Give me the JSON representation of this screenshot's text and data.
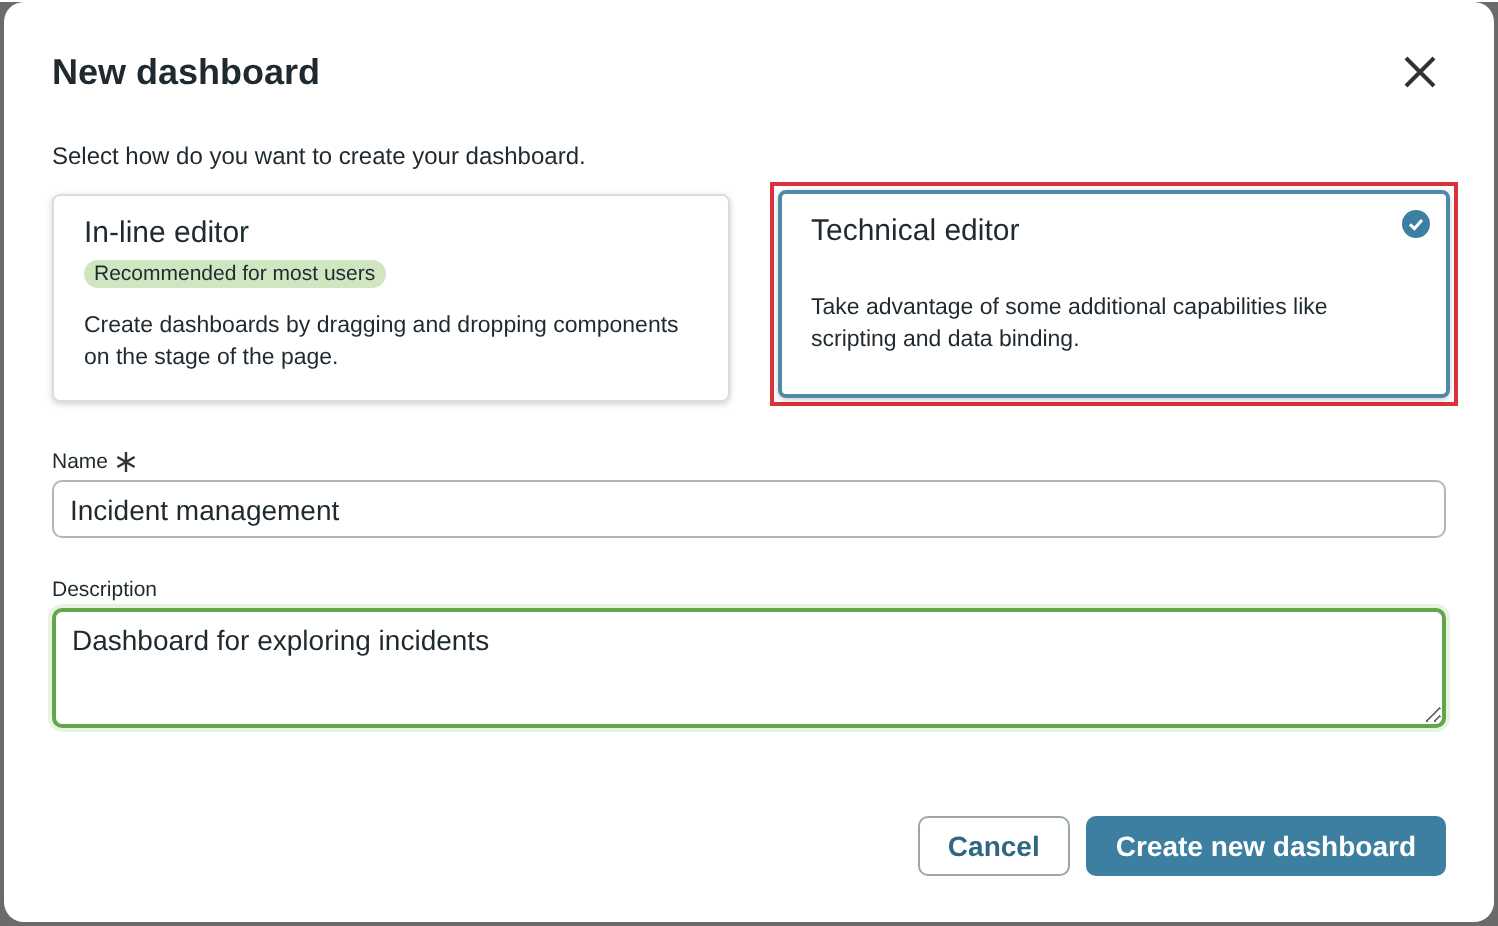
{
  "dialog": {
    "title": "New dashboard",
    "subtitle": "Select how do you want to create your dashboard."
  },
  "options": [
    {
      "title": "In-line editor",
      "badge": "Recommended for most users",
      "description": "Create dashboards by dragging and dropping components on the stage of the page.",
      "selected": false,
      "highlighted": false
    },
    {
      "title": "Technical editor",
      "description": "Take advantage of some additional capabilities like scripting and data binding.",
      "selected": true,
      "highlighted": true
    }
  ],
  "name_field": {
    "label": "Name",
    "required": true,
    "value": "Incident management"
  },
  "description_field": {
    "label": "Description",
    "value": "Dashboard for exploring incidents",
    "focused": true
  },
  "buttons": [
    {
      "label": "Cancel",
      "kind": "secondary"
    },
    {
      "label": "Create new dashboard",
      "kind": "primary"
    }
  ]
}
